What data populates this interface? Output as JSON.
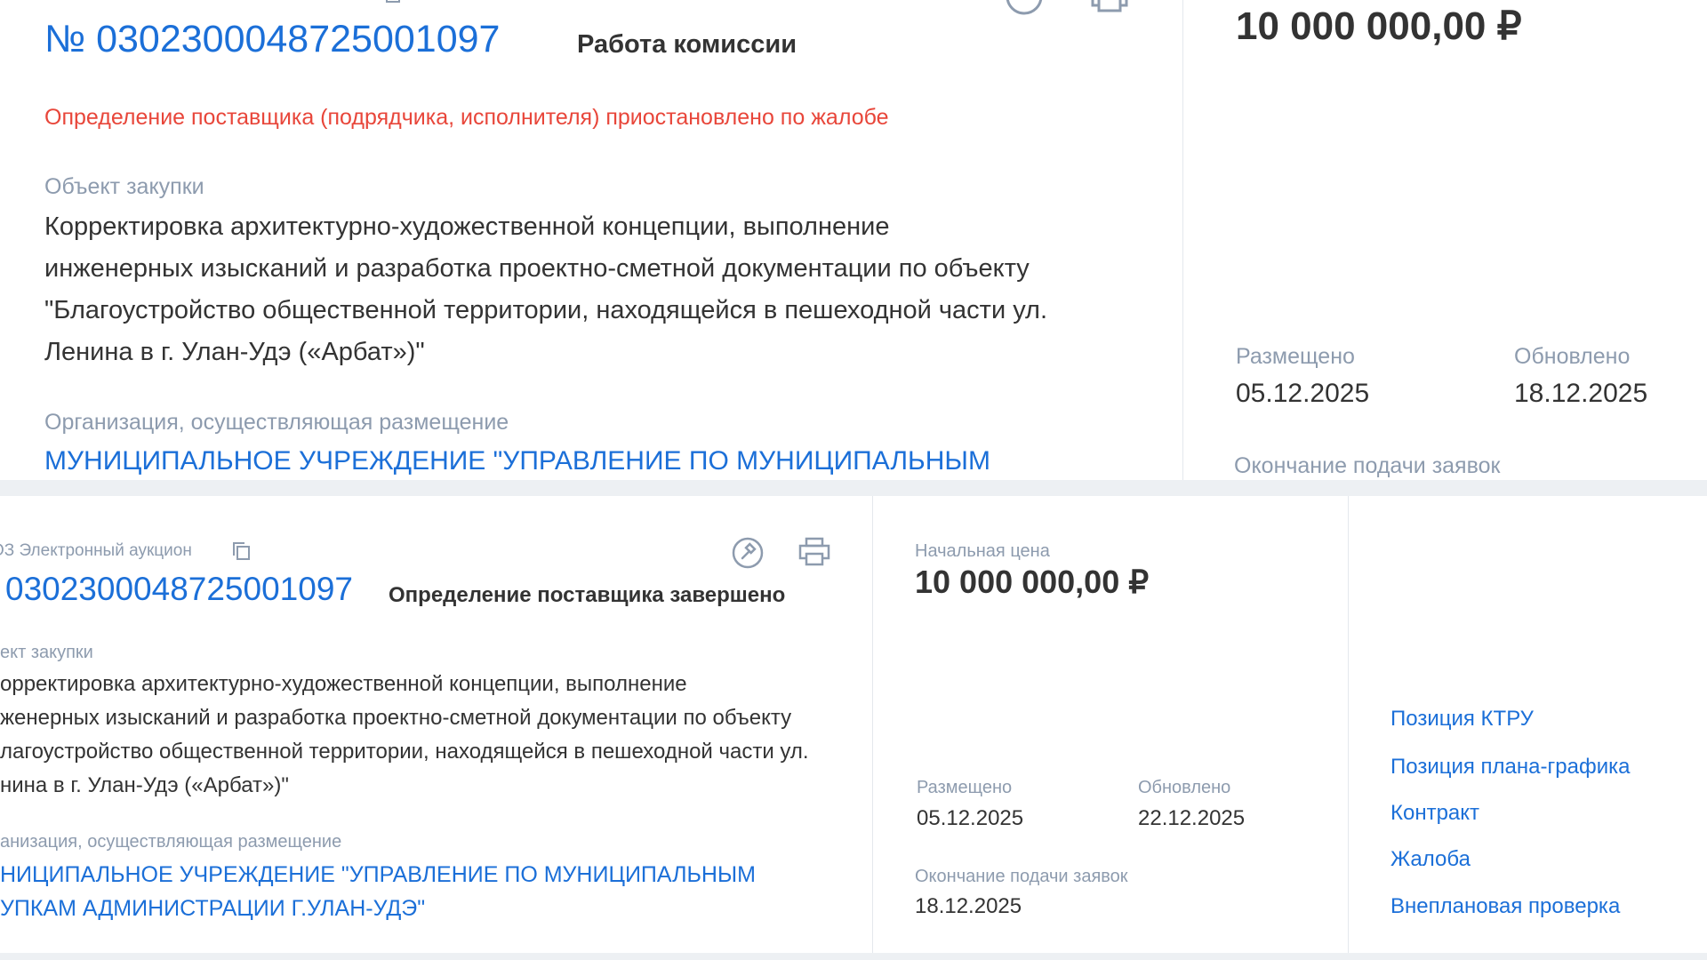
{
  "top_card": {
    "number": "№ 0302300048725001097",
    "status": "Работа комиссии",
    "alert": "Определение поставщика (подрядчика, исполнителя) приостановлено по жалобе",
    "object_label": "Объект закупки",
    "object_lines": [
      "Корректировка архитектурно-художественной концепции, выполнение",
      "инженерных изысканий и разработка проектно-сметной документации по объекту",
      "\"Благоустройство общественной территории, находящейся в пешеходной части ул.",
      "Ленина в г. Улан-Удэ («Арбат»)\""
    ],
    "org_label": "Организация, осуществляющая размещение",
    "org_name": "МУНИЦИПАЛЬНОЕ УЧРЕЖДЕНИЕ \"УПРАВЛЕНИЕ ПО МУНИЦИПАЛЬНЫМ",
    "price": "10 000 000,00 ₽",
    "placed_label": "Размещено",
    "placed_date": "05.12.2025",
    "updated_label": "Обновлено",
    "updated_date": "18.12.2025",
    "deadline_label": "Окончание подачи заявок"
  },
  "bottom_card": {
    "law_type": "ОЗ Электронный аукцион",
    "number": "0302300048725001097",
    "status": "Определение поставщика завершено",
    "object_label": "ект закупки",
    "object_lines": [
      "орректировка архитектурно-художественной концепции, выполнение",
      "женерных изысканий и разработка проектно-сметной документации по объекту",
      "лагоустройство общественной территории, находящейся в пешеходной части ул.",
      "нина в г. Улан-Удэ («Арбат»)\""
    ],
    "org_label": "анизация, осуществляющая размещение",
    "org_lines": [
      "НИЦИПАЛЬНОЕ УЧРЕЖДЕНИЕ \"УПРАВЛЕНИЕ ПО МУНИЦИПАЛЬНЫМ",
      "УПКАМ АДМИНИСТРАЦИИ Г.УЛАН-УДЭ\""
    ],
    "price_label": "Начальная цена",
    "price": "10 000 000,00 ₽",
    "placed_label": "Размещено",
    "placed_date": "05.12.2025",
    "updated_label": "Обновлено",
    "updated_date": "22.12.2025",
    "deadline_label": "Окончание подачи заявок",
    "deadline_date": "18.12.2025",
    "links": [
      "Позиция КТРУ",
      "Позиция плана-графика",
      "Контракт",
      "Жалоба",
      "Внеплановая проверка"
    ]
  },
  "colors": {
    "accent": "#1b6fd8",
    "alert": "#e8463a",
    "label": "#8d9bae",
    "text": "#333333"
  },
  "icons": [
    "copy-icon",
    "law-hammer-icon",
    "print-icon"
  ]
}
